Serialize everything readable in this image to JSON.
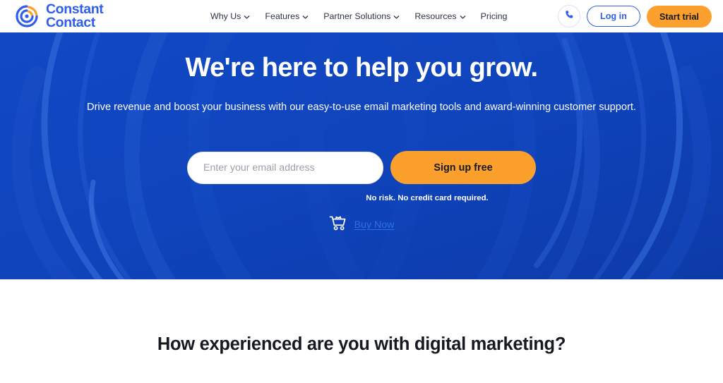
{
  "brand": {
    "name_line1": "Constant",
    "name_line2": "Contact",
    "logo_icon": "constant-contact-swirl-logo",
    "colors": {
      "logo_blue": "#2F5FEA",
      "logo_orange": "#FBA02C",
      "hero_blue": "#1046BE",
      "accent_orange": "#FBA02C",
      "link_blue": "#2F6FE2",
      "nav_text": "#2C3345"
    }
  },
  "nav": {
    "items": [
      {
        "label": "Why Us",
        "has_caret": true,
        "icon": "chevron-down-icon"
      },
      {
        "label": "Features",
        "has_caret": true,
        "icon": "chevron-down-icon"
      },
      {
        "label": "Partner Solutions",
        "has_caret": true,
        "icon": "chevron-down-icon"
      },
      {
        "label": "Resources",
        "has_caret": true,
        "icon": "chevron-down-icon"
      },
      {
        "label": "Pricing",
        "has_caret": false,
        "icon": ""
      }
    ],
    "actions": {
      "phone_icon": "phone-icon",
      "login_label": "Log in",
      "start_trial_label": "Start trial"
    }
  },
  "hero": {
    "title": "We're here to help you grow.",
    "subtitle": "Drive revenue and boost your business with our easy-to-use email marketing tools and award-winning customer support.",
    "email_placeholder": "Enter your email address",
    "email_value": "",
    "signup_label": "Sign up free",
    "disclaimer": "No risk. No credit card required.",
    "cart_icon": "shopping-cart-icon",
    "buy_now_label": "Buy Now"
  },
  "lower": {
    "heading": "How experienced are you with digital marketing?"
  }
}
